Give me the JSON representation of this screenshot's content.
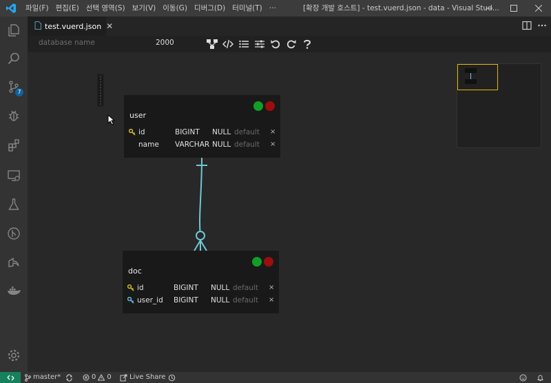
{
  "menu": [
    "파일(F)",
    "편집(E)",
    "선택 영역(S)",
    "보기(V)",
    "이동(G)",
    "디버그(D)",
    "터미널(T)",
    "···"
  ],
  "window_title": "[확장 개발 호스트] - test.vuerd.json - data - Visual Stud...",
  "tab": {
    "label": "test.vuerd.json"
  },
  "activity_badge": "7",
  "toolbar": {
    "database_name_placeholder": "database name",
    "canvas_size": "2000",
    "tools": [
      "relationship-icon",
      "code-icon",
      "list-icon",
      "sliders-icon",
      "undo-icon",
      "redo-icon",
      "help-icon"
    ]
  },
  "tables": [
    {
      "name": "user",
      "columns": [
        {
          "pk": true,
          "fk": false,
          "name": "id",
          "type": "BIGINT",
          "null": "NULL",
          "default": "default"
        },
        {
          "pk": false,
          "fk": false,
          "name": "name",
          "type": "VARCHAR",
          "null": "NULL",
          "default": "default"
        }
      ]
    },
    {
      "name": "doc",
      "columns": [
        {
          "pk": true,
          "fk": false,
          "name": "id",
          "type": "BIGINT",
          "null": "NULL",
          "default": "default"
        },
        {
          "pk": false,
          "fk": true,
          "name": "user_id",
          "type": "BIGINT",
          "null": "NULL",
          "default": "default"
        }
      ]
    }
  ],
  "delete_glyph": "×",
  "status": {
    "branch": "master*",
    "errors": "0",
    "warnings": "0",
    "live_share": "Live Share"
  },
  "colors": {
    "accent": "#0e639c",
    "remote": "#16825d",
    "relationship": "#6ecad6",
    "pk_key": "#c8b428",
    "fk_key": "#5bb6d6",
    "minimap_view": "#e6b800"
  }
}
